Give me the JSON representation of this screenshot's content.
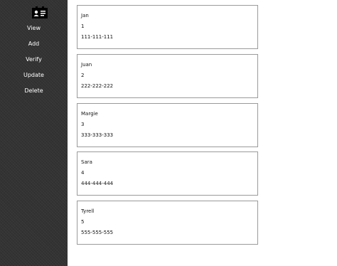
{
  "sidebar": {
    "logo_icon": "contact-card-icon",
    "items": [
      {
        "label": "View"
      },
      {
        "label": "Add"
      },
      {
        "label": "Verify"
      },
      {
        "label": "Update"
      },
      {
        "label": "Delete"
      }
    ]
  },
  "contacts": [
    {
      "name": "Jan",
      "id": "1",
      "phone": "111-111-111"
    },
    {
      "name": "Juan",
      "id": "2",
      "phone": "222-222-222"
    },
    {
      "name": "Margie",
      "id": "3",
      "phone": "333-333-333"
    },
    {
      "name": "Sara",
      "id": "4",
      "phone": "444-444-444"
    },
    {
      "name": "Tyrell",
      "id": "5",
      "phone": "555-555-555"
    }
  ],
  "colors": {
    "sidebar_bg": "#333333",
    "sidebar_text": "#ffffff",
    "card_border": "#9a9a9a"
  }
}
